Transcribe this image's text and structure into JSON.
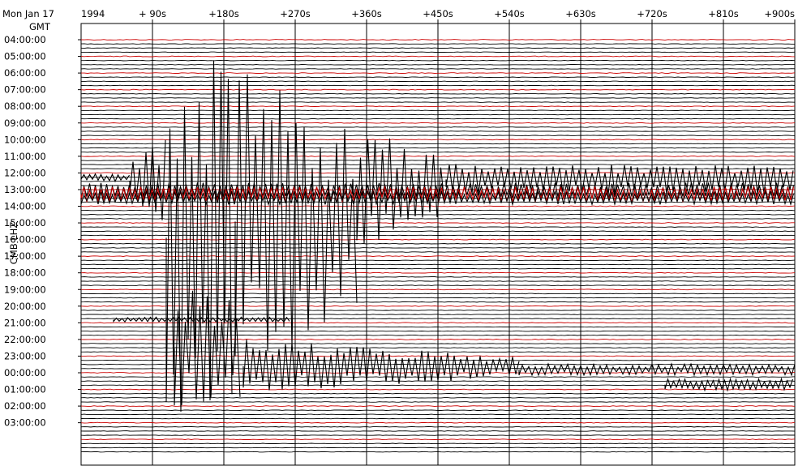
{
  "header": {
    "date": "Mon  Jan  17",
    "year": "1994",
    "timezone": "GMT"
  },
  "station_label": "CMB  LHZ",
  "colors": {
    "trace": "#000000",
    "alt_trace": "#cc0000",
    "frame": "#000000",
    "background": "#ffffff"
  },
  "chart_data": {
    "type": "line",
    "title": "",
    "x_tick_labels": [
      "+ 90s",
      "+180s",
      "+270s",
      "+360s",
      "+450s",
      "+540s",
      "+630s",
      "+720s",
      "+810s",
      "+900s"
    ],
    "x_ticks_seconds": [
      90,
      180,
      270,
      360,
      450,
      540,
      630,
      720,
      810,
      900
    ],
    "xlim": [
      0,
      900
    ],
    "hour_labels": [
      "04:00:00",
      "05:00:00",
      "06:00:00",
      "07:00:00",
      "08:00:00",
      "09:00:00",
      "10:00:00",
      "11:00:00",
      "12:00:00",
      "13:00:00",
      "14:00:00",
      "15:00:00",
      "16:00:00",
      "17:00:00",
      "18:00:00",
      "19:00:00",
      "20:00:00",
      "21:00:00",
      "22:00:00",
      "23:00:00",
      "00:00:00",
      "01:00:00",
      "02:00:00",
      "03:00:00"
    ],
    "traces_per_hour": 4,
    "red_trace_index": 0,
    "active_segments": [
      {
        "hour": "12:00:00",
        "onset_s": 58
      },
      {
        "hour": "13:00:00",
        "onset_s": 0
      },
      {
        "hour": "00:00:00",
        "onset_s": 0
      }
    ],
    "grid": true
  }
}
